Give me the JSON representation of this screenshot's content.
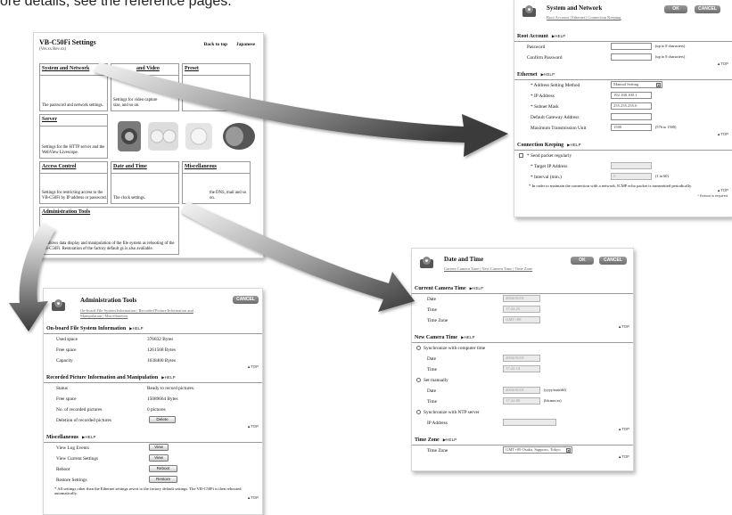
{
  "intro": "ore details, see the reference pages.",
  "home": {
    "title": "VB-C50Fi Settings",
    "subtitle": "(Ver.xx Rev.xx)",
    "nav": {
      "back_to_top": "Back to top",
      "japanese": "Japanese"
    },
    "cells": {
      "system": {
        "title": "System and Network",
        "desc": "The password and network settings."
      },
      "video": {
        "title": "and Video",
        "desc": "Settings for video capture size, and so on."
      },
      "preset": {
        "title": "Preset",
        "desc": ""
      },
      "server": {
        "title": "Server",
        "desc": "Settings for the HTTP server and the WebView Livescope."
      },
      "access": {
        "title": "Access Control",
        "desc": "Settings for restricting access to the VB-C50Fi by IP address or password."
      },
      "datetime": {
        "title": "Date and Time",
        "desc": "The clock settings."
      },
      "misc": {
        "title": "Miscellaneous",
        "desc": "the DNS, mail and so on."
      },
      "admin": {
        "title": "Administration Tools",
        "desc": "ge allows data display and manipulation of the file system as rebooting of the VB-C50Fi. Restoration of the factory default gs is also available."
      }
    }
  },
  "common": {
    "ok": "OK",
    "cancel": "CANCEL",
    "help": "▶HELP",
    "top": "▲TOP"
  },
  "net": {
    "title": "System and Network",
    "links": "Root Account | Ethernet | Connection Keeping",
    "root_account": {
      "heading": "Root Account",
      "password_label": "Password",
      "password_note": "(up to 8 characters)",
      "confirm_label": "Confirm Password",
      "confirm_note": "(up to 8 characters)"
    },
    "ethernet": {
      "heading": "Ethernet",
      "method_label": "* Address Setting Method",
      "method_value": "Manual Setting",
      "ip_label": "* IP Address",
      "ip_value": "192.168.100.1",
      "mask_label": "* Subnet Mask",
      "mask_value": "255.255.255.0",
      "gateway_label": "Default Gateway Address",
      "gateway_value": "",
      "mtu_label": "Maximum Transmission Unit",
      "mtu_value": "1500",
      "mtu_note": "(576 to 1500)"
    },
    "keeping": {
      "heading": "Connection Keeping",
      "send_label": "* Send packet regularly",
      "target_label": "* Target IP Address",
      "target_value": "",
      "interval_label": "* Interval (min.)",
      "interval_value": "5",
      "interval_note": "(1 to 60)",
      "note": "* In order to maintain the connection with a network, ICMP echo packet is transmitted periodically.",
      "reboot_note": "* Reboot is required."
    }
  },
  "dt": {
    "title": "Date and Time",
    "links": "Current Camera Time | New Camera Time | Time Zone",
    "current": {
      "heading": "Current Camera Time",
      "date_label": "Date",
      "date_value": "2004/01/01",
      "time_label": "Time",
      "time_value": "17:24:25",
      "tz_label": "Time Zone",
      "tz_value": "GMT+09"
    },
    "new": {
      "heading": "New Camera Time",
      "sync_pc_label": "Synchronize with computer time",
      "date_label": "Date",
      "date_value": "2004/01/01",
      "time_label": "Time",
      "time_value": "17:22:14",
      "manual_label": "Set manually",
      "mdate_value": "2004/01/01",
      "mdate_note": "(yyyy/mm/dd)",
      "mtime_value": "17:24:00",
      "mtime_note": "(hh:mm:ss)",
      "ntp_label": "Synchronize with NTP server",
      "ip_label": "IP Address",
      "ip_value": ""
    },
    "tz": {
      "heading": "Time Zone",
      "label": "Time Zone",
      "value": "GMT+09 Osaka, Sapporo, Tokyo"
    }
  },
  "adm": {
    "title": "Administration Tools",
    "links": "On-board File System Information | Recorded Picture Information and Manipulation | Miscellaneous",
    "fs": {
      "heading": "On-board File System Information",
      "used_label": "Used space",
      "used_value": "376832 Bytes",
      "free_label": "Free space",
      "free_value": "1261568 Bytes",
      "cap_label": "Capacity",
      "cap_value": "1638400 Bytes"
    },
    "rec": {
      "heading": "Recorded Picture Information and Manipulation",
      "status_label": "Status",
      "status_value": "Ready to record pictures.",
      "free_label": "Free space",
      "free_value": "15089664 Bytes",
      "num_label": "No. of recorded pictures",
      "num_value": "0 pictures",
      "del_label": "Deletion of recorded pictures",
      "del_button": "Delete"
    },
    "misc": {
      "heading": "Miscellaneous",
      "log_label": "View Log Events",
      "log_button": "View",
      "cur_label": "View Current Settings",
      "cur_button": "View",
      "reboot_label": "Reboot",
      "reboot_button": "Reboot",
      "restore_label": "Restore Settings",
      "restore_button": "Restore",
      "note": "* All settings other than the Ethernet settings revert to the factory default settings. The VB-C50Fi is then rebooted automatically."
    }
  },
  "colors": {
    "arrow_light": "#f0f0f0",
    "arrow_dark": "#3a3a3a",
    "button": "#7c7c7c",
    "border": "#999999"
  }
}
